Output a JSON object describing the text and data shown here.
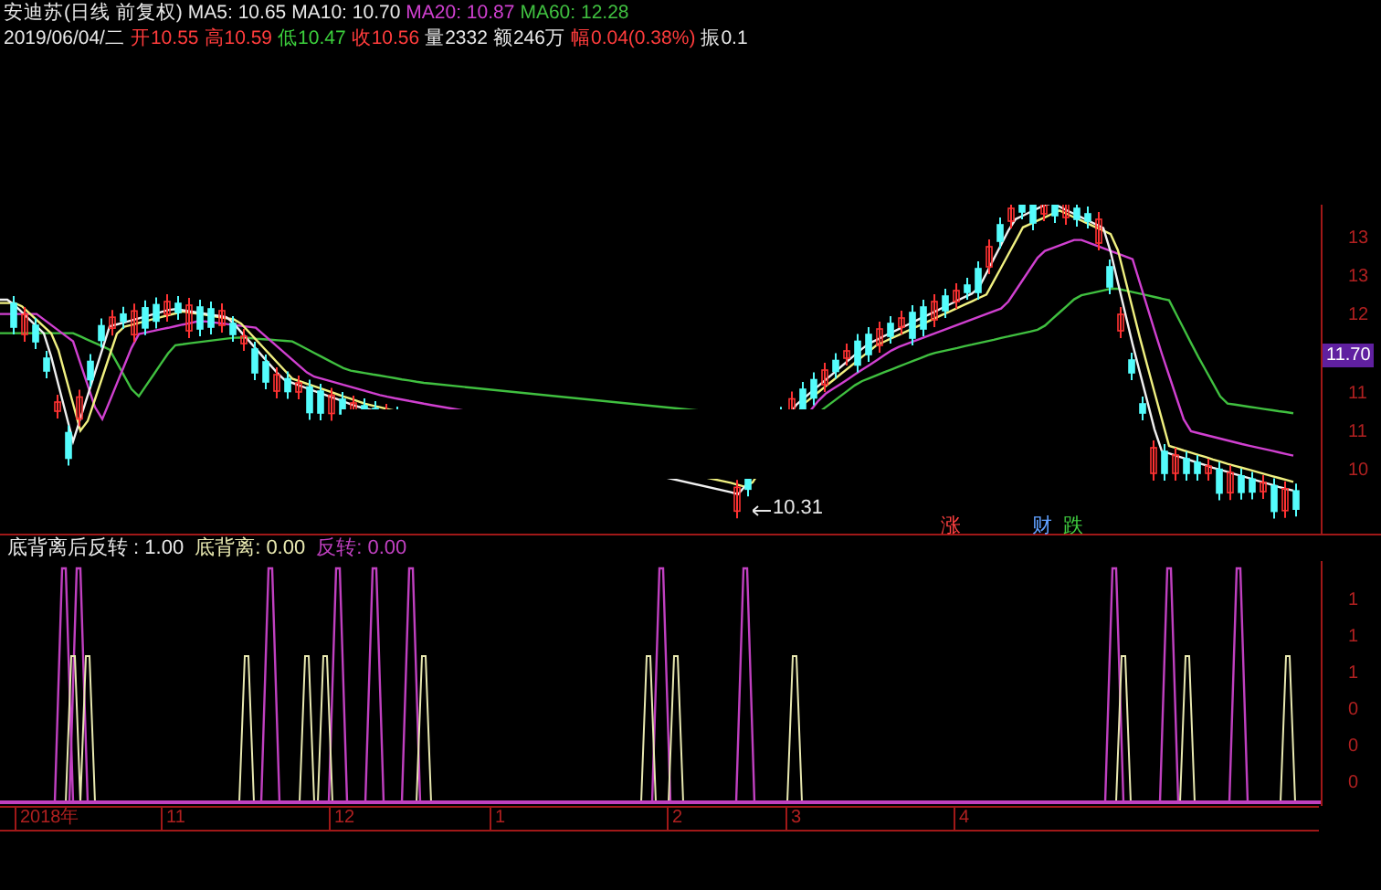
{
  "header": {
    "title": "安迪苏(日线 前复权)",
    "moving_averages": [
      {
        "label": "MA5: 10.65",
        "color": "#e8e8e8"
      },
      {
        "label": "MA10: 10.70",
        "color": "#e8e8e8"
      },
      {
        "label": "MA20: 10.87",
        "color": "#d040d0"
      },
      {
        "label": "MA60: 12.28",
        "color": "#40c040"
      }
    ],
    "date": "2019/06/04/二",
    "quotes": [
      {
        "label": "开",
        "value": "10.55",
        "color": "#ff3c3c"
      },
      {
        "label": "高",
        "value": "10.59",
        "color": "#ff3c3c"
      },
      {
        "label": "低",
        "value": "10.47",
        "color": "#3cd03c"
      },
      {
        "label": "收",
        "value": "10.56",
        "color": "#ff3c3c"
      },
      {
        "label": "量",
        "value": "2332",
        "color": "#e8e8e8"
      },
      {
        "label": "额",
        "value": "246万",
        "color": "#e8e8e8"
      },
      {
        "label": "幅",
        "value": "0.04(0.38%)",
        "color": "#ff3c3c"
      },
      {
        "label": "振",
        "value": "0.1",
        "color": "#e8e8e8"
      }
    ]
  },
  "price_axis": [
    {
      "kind": "tick",
      "label": "13"
    },
    {
      "kind": "tick",
      "label": "13"
    },
    {
      "kind": "tick",
      "label": "12"
    },
    {
      "kind": "current",
      "label": "11.70"
    },
    {
      "kind": "tick",
      "label": "11"
    },
    {
      "kind": "tick",
      "label": "11"
    },
    {
      "kind": "tick",
      "label": "10"
    }
  ],
  "low_marker": "10.31",
  "event_marks": [
    {
      "label": "涨",
      "color": "#ff4040"
    },
    {
      "label": "财",
      "color": "#60a0ff"
    },
    {
      "label": "跌",
      "color": "#40d040"
    }
  ],
  "indicator": {
    "values": [
      {
        "label": "底背离后反转 : 1.00",
        "color": "#e8e8e8"
      },
      {
        "label": "底背离: 0.00",
        "color": "#e8e8b0"
      },
      {
        "label": "反转: 0.00",
        "color": "#c040c0"
      }
    ],
    "axis": [
      "1",
      "1",
      "1",
      "0",
      "0",
      "0"
    ]
  },
  "time_axis": [
    "2018年",
    "11",
    "12",
    "1",
    "2",
    "3",
    "4"
  ]
}
